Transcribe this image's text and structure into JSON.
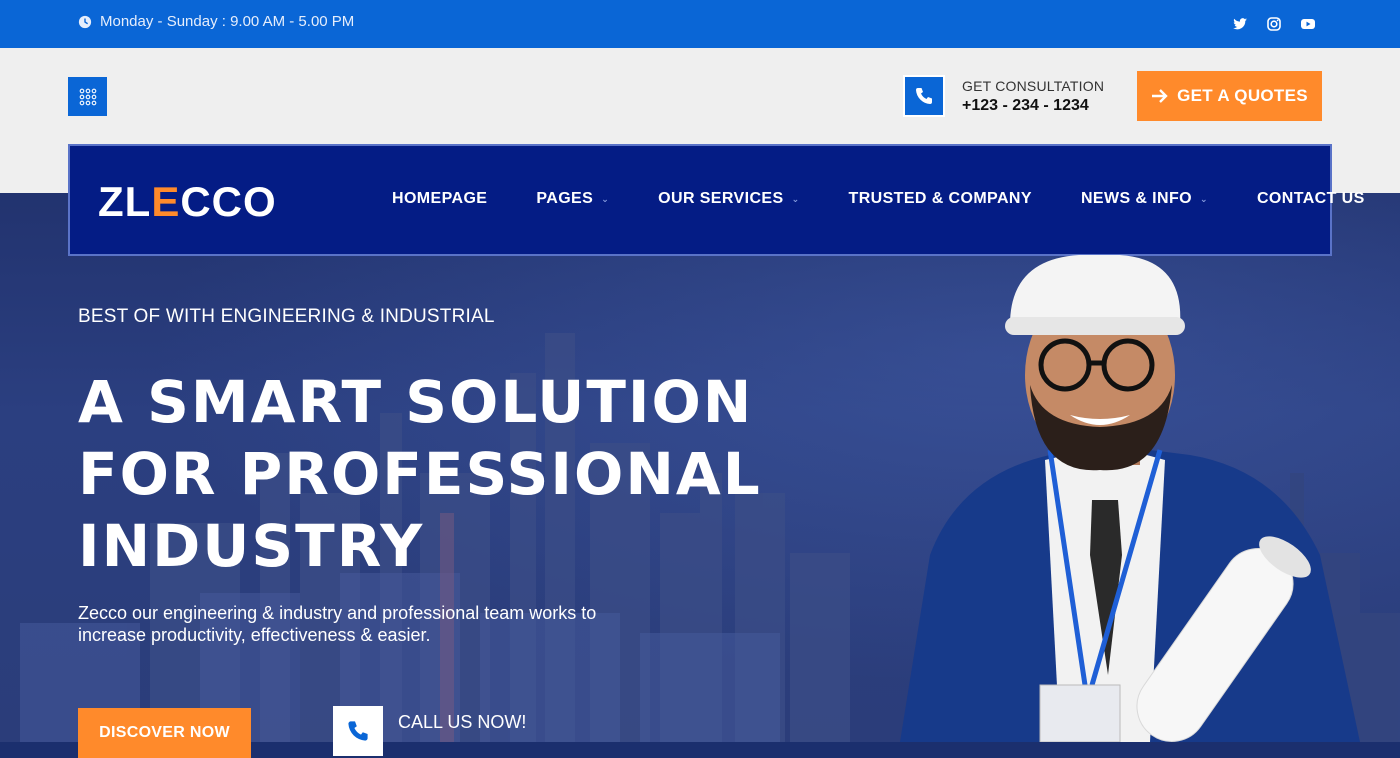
{
  "topbar": {
    "hours": "Monday - Sunday : 9.00 AM - 5.00 PM",
    "icons": [
      "clock-icon",
      "twitter-icon",
      "instagram-icon",
      "youtube-icon"
    ]
  },
  "header": {
    "consult_label": "GET CONSULTATION",
    "consult_phone": "+123 - 234 - 1234",
    "quote_label": "GET A QUOTES"
  },
  "nav": {
    "logo_a": "ZL",
    "logo_e": "E",
    "logo_b": "CCO",
    "items": [
      {
        "label": "HOMEPAGE",
        "dropdown": false
      },
      {
        "label": "PAGES",
        "dropdown": true
      },
      {
        "label": "OUR SERVICES",
        "dropdown": true
      },
      {
        "label": "TRUSTED & COMPANY",
        "dropdown": false
      },
      {
        "label": "NEWS & INFO",
        "dropdown": true
      },
      {
        "label": "CONTACT US",
        "dropdown": false
      }
    ]
  },
  "hero": {
    "eyebrow": "BEST OF WITH ENGINEERING & INDUSTRIAL",
    "headline_1": "A SMART SOLUTION",
    "headline_2": "FOR PROFESSIONAL",
    "headline_3": "INDUSTRY",
    "description": "Zecco our engineering & industry and professional team works to increase productivity, effectiveness & easier.",
    "discover_label": "DISCOVER NOW",
    "call_label": "CALL US NOW!"
  },
  "colors": {
    "primary": "#0a66d6",
    "navy": "#041c85",
    "accent": "#ff8a2b"
  }
}
